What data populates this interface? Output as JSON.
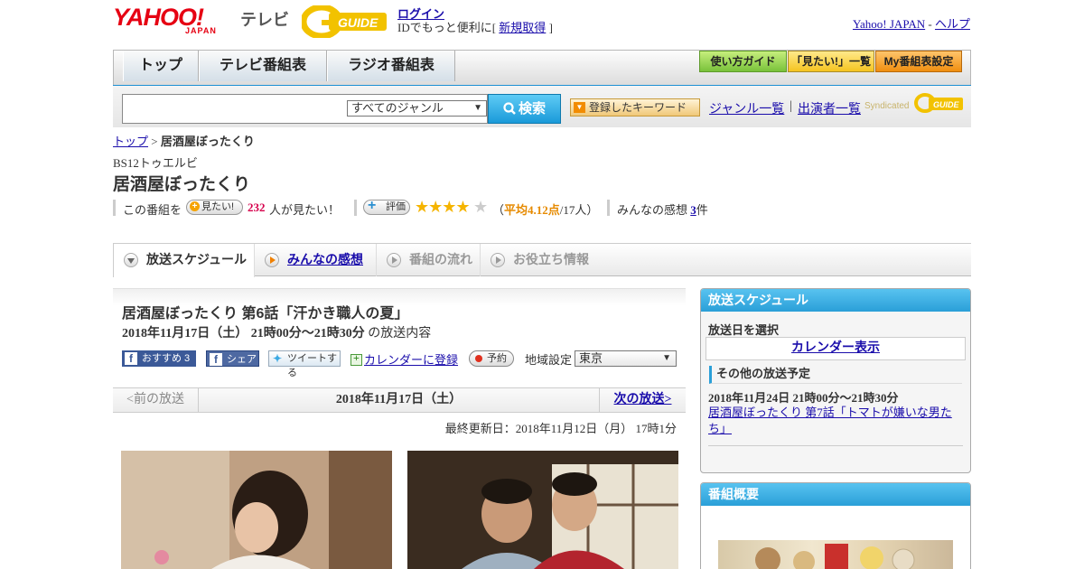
{
  "header": {
    "logo_yahoo": "YAHOO!",
    "logo_japan": "JAPAN",
    "logo_tv": "テレビ",
    "gguide_logo": "G-GUIDE",
    "login_link": "ログイン",
    "login_prefix": "IDでもっと便利に[",
    "register_link": "新規取得",
    "login_suffix": "]",
    "yahoo_japan_link": "Yahoo! JAPAN",
    "dash": "-",
    "help_link": "ヘルプ"
  },
  "nav": {
    "tabs": [
      "トップ",
      "テレビ番組表",
      "ラジオ番組表"
    ],
    "buttons": [
      "使い方ガイド",
      "「見たい!」一覧",
      "My番組表設定"
    ]
  },
  "search": {
    "input_value": "",
    "genre_selected": "すべてのジャンル",
    "search_button": "検索",
    "keyword_button": "登録したキーワード",
    "genre_list_link": "ジャンル一覧",
    "separator": "|",
    "cast_list_link": "出演者一覧",
    "syndicated": "Syndicated"
  },
  "program": {
    "breadcrumb_top": "トップ",
    "breadcrumb_sep": ">",
    "breadcrumb_current": "居酒屋ぼったくり",
    "channel": "BS12トゥエルビ",
    "title": "居酒屋ぼったくり",
    "want_prefix": "この番組を",
    "want_button": "見たい!",
    "want_count": "232",
    "want_suffix": "人が見たい！",
    "rating_button": "評価",
    "rating_stars": "★★★★",
    "rating_empty_star": "★",
    "rating_open": "（",
    "rating_avg": "平均4.12点",
    "rating_people": "/17人）",
    "comments_label": "みんなの感想",
    "comments_count": "3",
    "comments_unit": "件"
  },
  "tabs": [
    {
      "label": "放送スケジュール"
    },
    {
      "label": "みんなの感想"
    },
    {
      "label": "番組の流れ"
    },
    {
      "label": "お役立ち情報"
    }
  ],
  "episode": {
    "title": "居酒屋ぼったくり 第6話「汗かき職人の夏」",
    "date": "2018年11月17日（土） 21時00分～21時30分",
    "date_suffix": "の放送内容",
    "fb_recommend": "おすすめ 3",
    "fb_share": "シェア",
    "tweet": "ツイートする",
    "calendar_register": "カレンダーに登録",
    "reserve": "予約",
    "region_label": "地域設定",
    "region_selected": "東京"
  },
  "date_nav": {
    "prev": "<前の放送",
    "current": "2018年11月17日（土）",
    "next": "次の放送>"
  },
  "updated": "最終更新日：2018年11月12日（月） 17時1分",
  "sidebar": {
    "schedule_title": "放送スケジュール",
    "select_date": "放送日を選択",
    "calendar_link": "カレンダー表示",
    "other_title": "その他の放送予定",
    "other_date": "2018年11月24日 21時00分～21時30分",
    "other_link": "居酒屋ぼったくり 第7話「トマトが嫌いな男たち」",
    "overview_title": "番組概要"
  },
  "colors": {
    "yahoo_red": "#e60012",
    "nav_blue": "#1e90d4",
    "link": "#1a0dab",
    "star": "#f5b400",
    "want_count": "#d6004c"
  }
}
